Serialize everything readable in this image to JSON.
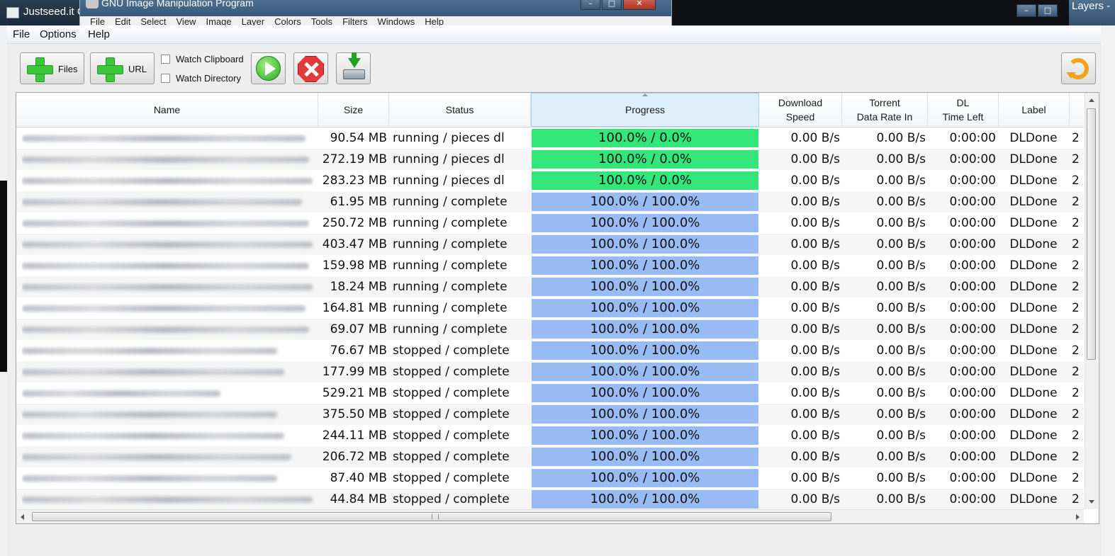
{
  "background": {
    "left_window_title": "Justseed.it C",
    "gimp_title": "GNU Image Manipulation Program",
    "gimp_menu": [
      "File",
      "Edit",
      "Select",
      "View",
      "Image",
      "Layer",
      "Colors",
      "Tools",
      "Filters",
      "Windows",
      "Help"
    ],
    "layers_title": "Layers -"
  },
  "menubar": {
    "items": [
      "File",
      "Options",
      "Help"
    ]
  },
  "toolbar": {
    "add_files_label": "Files",
    "add_url_label": "URL",
    "watch_clipboard_label": "Watch Clipboard",
    "watch_directory_label": "Watch Directory",
    "watch_clipboard_checked": false,
    "watch_directory_checked": false
  },
  "table": {
    "headers": {
      "name": "Name",
      "size": "Size",
      "status": "Status",
      "progress": "Progress",
      "download_speed": "Download\nSpeed",
      "torrent_rate": "Torrent\nData Rate In",
      "dl_time_left": "DL\nTime Left",
      "label": "Label"
    },
    "sorted_column": "progress",
    "rows": [
      {
        "size": "90.54 MB",
        "status": "running / pieces dl",
        "progress": "100.0% / 0.0%",
        "state": "green",
        "speed": "0.00 B/s",
        "rate": "0.00 B/s",
        "time": "0:00:00",
        "label": "DLDone",
        "extra": "2"
      },
      {
        "size": "272.19 MB",
        "status": "running / pieces dl",
        "progress": "100.0% / 0.0%",
        "state": "green",
        "speed": "0.00 B/s",
        "rate": "0.00 B/s",
        "time": "0:00:00",
        "label": "DLDone",
        "extra": "2"
      },
      {
        "size": "283.23 MB",
        "status": "running / pieces dl",
        "progress": "100.0% / 0.0%",
        "state": "green",
        "speed": "0.00 B/s",
        "rate": "0.00 B/s",
        "time": "0:00:00",
        "label": "DLDone",
        "extra": "2"
      },
      {
        "size": "61.95 MB",
        "status": "running / complete",
        "progress": "100.0% / 100.0%",
        "state": "blue",
        "speed": "0.00 B/s",
        "rate": "0.00 B/s",
        "time": "0:00:00",
        "label": "DLDone",
        "extra": "2"
      },
      {
        "size": "250.72 MB",
        "status": "running / complete",
        "progress": "100.0% / 100.0%",
        "state": "blue",
        "speed": "0.00 B/s",
        "rate": "0.00 B/s",
        "time": "0:00:00",
        "label": "DLDone",
        "extra": "2"
      },
      {
        "size": "403.47 MB",
        "status": "running / complete",
        "progress": "100.0% / 100.0%",
        "state": "blue",
        "speed": "0.00 B/s",
        "rate": "0.00 B/s",
        "time": "0:00:00",
        "label": "DLDone",
        "extra": "2"
      },
      {
        "size": "159.98 MB",
        "status": "running / complete",
        "progress": "100.0% / 100.0%",
        "state": "blue",
        "speed": "0.00 B/s",
        "rate": "0.00 B/s",
        "time": "0:00:00",
        "label": "DLDone",
        "extra": "2"
      },
      {
        "size": "18.24 MB",
        "status": "running / complete",
        "progress": "100.0% / 100.0%",
        "state": "blue",
        "speed": "0.00 B/s",
        "rate": "0.00 B/s",
        "time": "0:00:00",
        "label": "DLDone",
        "extra": "2"
      },
      {
        "size": "164.81 MB",
        "status": "running / complete",
        "progress": "100.0% / 100.0%",
        "state": "blue",
        "speed": "0.00 B/s",
        "rate": "0.00 B/s",
        "time": "0:00:00",
        "label": "DLDone",
        "extra": "2"
      },
      {
        "size": "69.07 MB",
        "status": "running / complete",
        "progress": "100.0% / 100.0%",
        "state": "blue",
        "speed": "0.00 B/s",
        "rate": "0.00 B/s",
        "time": "0:00:00",
        "label": "DLDone",
        "extra": "2"
      },
      {
        "size": "76.67 MB",
        "status": "stopped / complete",
        "progress": "100.0% / 100.0%",
        "state": "blue",
        "speed": "0.00 B/s",
        "rate": "0.00 B/s",
        "time": "0:00:00",
        "label": "DLDone",
        "extra": "2"
      },
      {
        "size": "177.99 MB",
        "status": "stopped / complete",
        "progress": "100.0% / 100.0%",
        "state": "blue",
        "speed": "0.00 B/s",
        "rate": "0.00 B/s",
        "time": "0:00:00",
        "label": "DLDone",
        "extra": "2"
      },
      {
        "size": "529.21 MB",
        "status": "stopped / complete",
        "progress": "100.0% / 100.0%",
        "state": "blue",
        "speed": "0.00 B/s",
        "rate": "0.00 B/s",
        "time": "0:00:00",
        "label": "DLDone",
        "extra": "2"
      },
      {
        "size": "375.50 MB",
        "status": "stopped / complete",
        "progress": "100.0% / 100.0%",
        "state": "blue",
        "speed": "0.00 B/s",
        "rate": "0.00 B/s",
        "time": "0:00:00",
        "label": "DLDone",
        "extra": "2"
      },
      {
        "size": "244.11 MB",
        "status": "stopped / complete",
        "progress": "100.0% / 100.0%",
        "state": "blue",
        "speed": "0.00 B/s",
        "rate": "0.00 B/s",
        "time": "0:00:00",
        "label": "DLDone",
        "extra": "2"
      },
      {
        "size": "206.72 MB",
        "status": "stopped / complete",
        "progress": "100.0% / 100.0%",
        "state": "blue",
        "speed": "0.00 B/s",
        "rate": "0.00 B/s",
        "time": "0:00:00",
        "label": "DLDone",
        "extra": "2"
      },
      {
        "size": "87.40 MB",
        "status": "stopped / complete",
        "progress": "100.0% / 100.0%",
        "state": "blue",
        "speed": "0.00 B/s",
        "rate": "0.00 B/s",
        "time": "0:00:00",
        "label": "DLDone",
        "extra": "2"
      },
      {
        "size": "44.84 MB",
        "status": "stopped / complete",
        "progress": "100.0% / 100.0%",
        "state": "blue",
        "speed": "0.00 B/s",
        "rate": "0.00 B/s",
        "time": "0:00:00",
        "label": "DLDone",
        "extra": "2"
      }
    ]
  },
  "colors": {
    "progress_partial": "#33e67a",
    "progress_complete": "#99bbf4",
    "sorted_header": "#ddeffa"
  },
  "icons": {
    "add_files": "plus-icon",
    "add_url": "plus-icon",
    "start": "play-icon",
    "stop": "stop-icon",
    "download": "download-icon",
    "refresh": "refresh-icon"
  }
}
